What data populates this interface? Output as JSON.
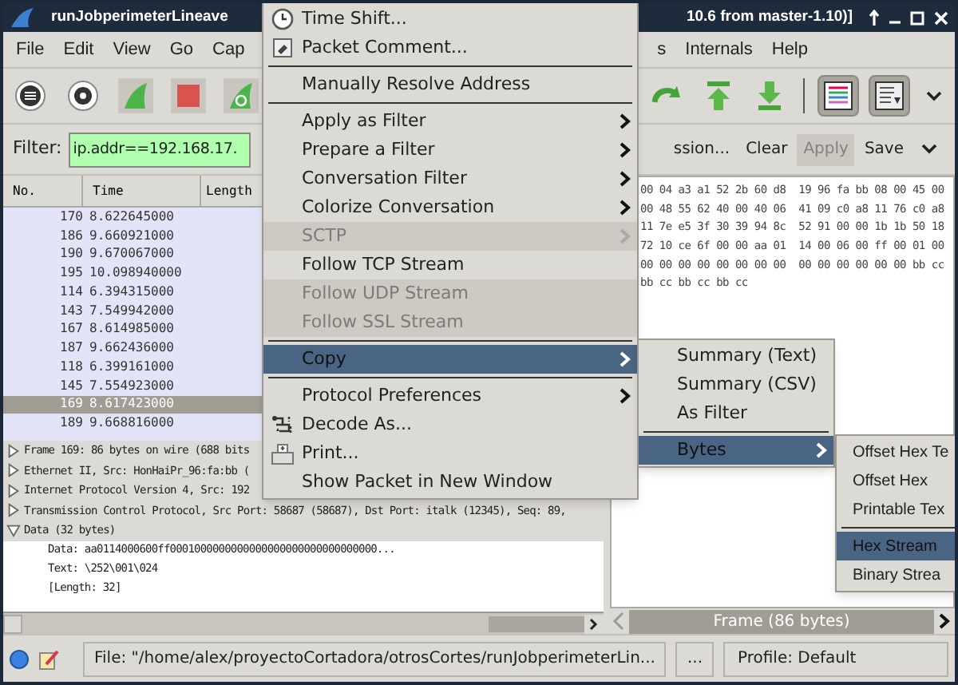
{
  "window": {
    "title_left": "runJobperimeterLineave",
    "title_right": "10.6 from master-1.10)]"
  },
  "menubar": {
    "left": [
      "File",
      "Edit",
      "View",
      "Go",
      "Cap"
    ],
    "right": [
      "s",
      "Internals",
      "Help"
    ]
  },
  "toolbar": {
    "toggles": [
      {
        "kind": "colorize",
        "pressed": true
      },
      {
        "kind": "autoscroll",
        "pressed": true
      }
    ]
  },
  "filter": {
    "label": "Filter:",
    "value": "ip.addr==192.168.17.",
    "buttons": [
      {
        "label": "ssion...",
        "disabled": false
      },
      {
        "label": "Clear",
        "disabled": false
      },
      {
        "label": "Apply",
        "disabled": true
      },
      {
        "label": "Save",
        "disabled": false
      }
    ]
  },
  "packet_list": {
    "columns": [
      "No.",
      "Time",
      "Length"
    ],
    "rows": [
      {
        "no": "170",
        "time": "8.622645000",
        "selected": false
      },
      {
        "no": "186",
        "time": "9.660921000",
        "selected": false
      },
      {
        "no": "190",
        "time": "9.670067000",
        "selected": false
      },
      {
        "no": "195",
        "time": "10.098940000",
        "selected": false
      },
      {
        "no": "114",
        "time": "6.394315000",
        "selected": false
      },
      {
        "no": "143",
        "time": "7.549942000",
        "selected": false
      },
      {
        "no": "167",
        "time": "8.614985000",
        "selected": false
      },
      {
        "no": "187",
        "time": "9.662436000",
        "selected": false
      },
      {
        "no": "118",
        "time": "6.399161000",
        "selected": false
      },
      {
        "no": "145",
        "time": "7.554923000",
        "selected": false
      },
      {
        "no": "169",
        "time": "8.617423000",
        "selected": true
      },
      {
        "no": "189",
        "time": "9.668816000",
        "selected": false
      }
    ]
  },
  "details": [
    {
      "label": "Frame 169: 86 bytes on wire (688 bits",
      "expanded": false
    },
    {
      "label": "Ethernet II, Src: HonHaiPr_96:fa:bb (",
      "expanded": false
    },
    {
      "label": "Internet Protocol Version 4, Src: 192",
      "expanded": false
    },
    {
      "label": "Transmission Control Protocol, Src Port: 58687 (58687), Dst Port: italk (12345), Seq: 89,",
      "expanded": false
    },
    {
      "label": "Data (32 bytes)",
      "expanded": true,
      "children": [
        {
          "label": "Data: aa0114000600ff0001000000000000000000000000000000..."
        },
        {
          "label": "Text: \\252\\001\\024"
        },
        {
          "label": "[Length: 32]"
        }
      ]
    }
  ],
  "hex_lines": [
    "00 04 a3 a1 52 2b 60 d8  19 96 fa bb 08 00 45 00",
    "00 48 55 62 40 00 40 06  41 09 c0 a8 11 76 c0 a8",
    "11 7e e5 3f 30 39 94 8c  52 91 00 00 1b 1b 50 18",
    "72 10 ce 6f 00 00 aa 01  14 00 06 00 ff 00 01 00",
    "00 00 00 00 00 00 00 00  00 00 00 00 00 00 bb cc",
    "bb cc bb cc bb cc"
  ],
  "bytes_tab": "Frame (86 bytes)",
  "status_bar": {
    "file": "File: \"/home/alex/proyectoCortadora/otrosCortes/runJobperimeterLin...",
    "more": "...",
    "profile": "Profile: Default"
  },
  "context_menu": [
    {
      "kind": "clock",
      "label": "Time Shift...",
      "disabled": false,
      "selected": false,
      "submenu": false
    },
    {
      "kind": "comment",
      "label": "Packet Comment...",
      "disabled": false,
      "selected": false,
      "submenu": false
    },
    {
      "kind": "separator"
    },
    {
      "kind": "item",
      "label": "Manually Resolve Address",
      "disabled": false,
      "selected": false,
      "submenu": false
    },
    {
      "kind": "separator"
    },
    {
      "kind": "item",
      "label": "Apply as Filter",
      "disabled": false,
      "selected": false,
      "submenu": true
    },
    {
      "kind": "item",
      "label": "Prepare a Filter",
      "disabled": false,
      "selected": false,
      "submenu": true
    },
    {
      "kind": "item",
      "label": "Conversation Filter",
      "disabled": false,
      "selected": false,
      "submenu": true
    },
    {
      "kind": "item",
      "label": "Colorize Conversation",
      "disabled": false,
      "selected": false,
      "submenu": true
    },
    {
      "kind": "item",
      "label": "SCTP",
      "disabled": true,
      "selected": false,
      "submenu": true
    },
    {
      "kind": "item",
      "label": "Follow TCP Stream",
      "disabled": false,
      "selected": false,
      "submenu": false
    },
    {
      "kind": "item",
      "label": "Follow UDP Stream",
      "disabled": true,
      "selected": false,
      "submenu": false
    },
    {
      "kind": "item",
      "label": "Follow SSL Stream",
      "disabled": true,
      "selected": false,
      "submenu": false
    },
    {
      "kind": "separator"
    },
    {
      "kind": "item",
      "label": "Copy",
      "disabled": false,
      "selected": true,
      "submenu": true
    },
    {
      "kind": "separator"
    },
    {
      "kind": "item",
      "label": "Protocol Preferences",
      "disabled": false,
      "selected": false,
      "submenu": true
    },
    {
      "kind": "decode",
      "label": "Decode As...",
      "disabled": false,
      "selected": false,
      "submenu": false
    },
    {
      "kind": "print",
      "label": "Print...",
      "disabled": false,
      "selected": false,
      "submenu": false
    },
    {
      "kind": "item",
      "label": "Show Packet in New Window",
      "disabled": false,
      "selected": false,
      "submenu": false
    }
  ],
  "copy_submenu": [
    {
      "kind": "item",
      "label": "Summary (Text)",
      "selected": false,
      "submenu": false
    },
    {
      "kind": "item",
      "label": "Summary (CSV)",
      "selected": false,
      "submenu": false
    },
    {
      "kind": "item",
      "label": "As Filter",
      "selected": false,
      "submenu": false
    },
    {
      "kind": "separator"
    },
    {
      "kind": "item",
      "label": "Bytes",
      "selected": true,
      "submenu": true
    }
  ],
  "bytes_submenu": [
    {
      "kind": "item",
      "label": "Offset Hex Te",
      "selected": false
    },
    {
      "kind": "item",
      "label": "Offset Hex",
      "selected": false
    },
    {
      "kind": "item",
      "label": "Printable Tex",
      "selected": false
    },
    {
      "kind": "separator"
    },
    {
      "kind": "item",
      "label": "Hex Stream",
      "selected": true
    },
    {
      "kind": "item",
      "label": "Binary Strea",
      "selected": false
    }
  ]
}
